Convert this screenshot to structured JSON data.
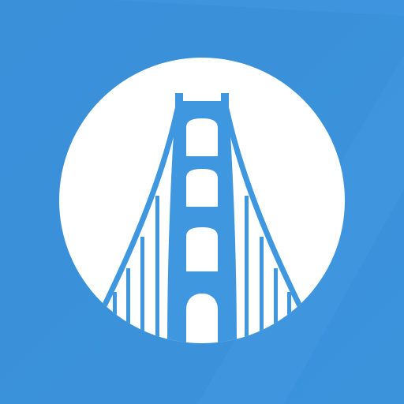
{
  "icon": {
    "name": "golden-gate-bridge-icon",
    "colors": {
      "background": "#3b92da",
      "background_highlight": "#4a9fe6",
      "disc": "#ffffff",
      "bridge": "#3f97df"
    }
  }
}
